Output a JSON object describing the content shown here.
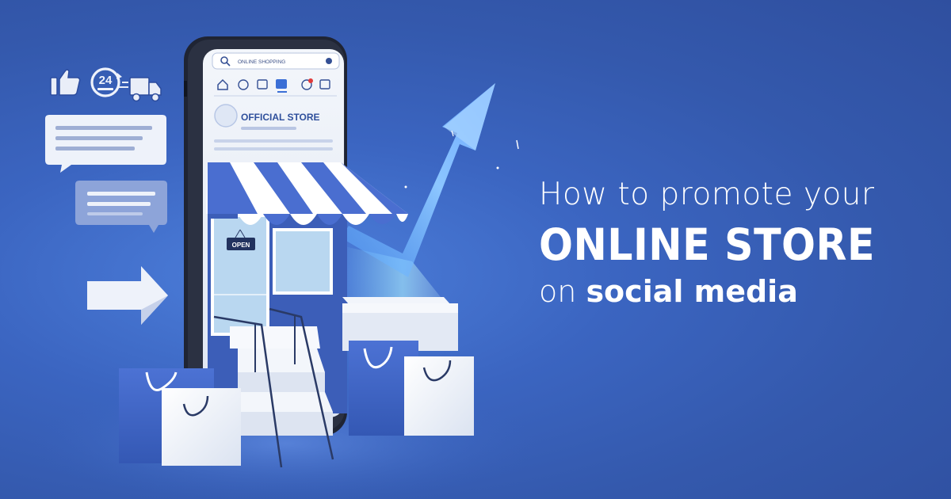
{
  "headline": {
    "line1": "How to promote your",
    "line2": "ONLINE STORE",
    "line3_prefix": "on",
    "line3_emphasis": "social media"
  },
  "phone": {
    "search_text": "ONLINE SHOPPING",
    "store_title": "OFFICIAL STORE",
    "open_sign": "OPEN"
  },
  "badge_24": "24",
  "colors": {
    "background": "#3b65c1",
    "accent_arrow": "#7fb8ff",
    "awning_stripe": "#4a6ed0",
    "text": "#ffffff"
  },
  "icons": [
    "thumbs-up-icon",
    "clock-24-icon",
    "truck-icon",
    "search-icon",
    "home-icon",
    "arrow-right-icon",
    "growth-arrow-icon",
    "shopping-bag-icon"
  ]
}
